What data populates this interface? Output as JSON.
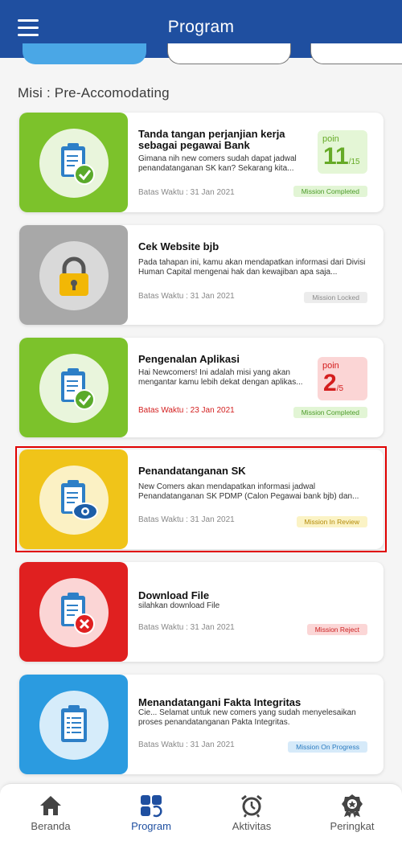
{
  "app": {
    "title": "Program"
  },
  "section": {
    "title": "Misi : Pre-Accomodating"
  },
  "missions": [
    {
      "title": "Tanda tangan perjanjian kerja sebagai pegawai Bank",
      "description": "Gimana nih new comers sudah dapat jadwal penandatanganan SK kan? Sekarang kita...",
      "deadline": "Batas Waktu : 31 Jan 2021",
      "status": "Mission Completed",
      "poin": {
        "label": "poin",
        "value": "11",
        "max": "/15"
      },
      "icon": "clipboard-check-icon",
      "tile_color": "#7cc22b"
    },
    {
      "title": "Cek Website bjb",
      "description": "Pada tahapan ini, kamu akan mendapatkan informasi dari Divisi Human Capital mengenai hak dan kewajiban apa saja...",
      "deadline": "Batas Waktu : 31 Jan 2021",
      "status": "Mission Locked",
      "icon": "padlock-icon",
      "tile_color": "#a8a8a8"
    },
    {
      "title": "Pengenalan Aplikasi",
      "description": "Hai Newcomers! Ini adalah misi yang akan mengantar kamu lebih dekat dengan aplikas...",
      "deadline": "Batas Waktu : 23 Jan 2021",
      "status": "Mission Completed",
      "poin": {
        "label": "poin",
        "value": "2",
        "max": "/5"
      },
      "icon": "clipboard-check-icon",
      "tile_color": "#7cc22b"
    },
    {
      "title": "Penandatanganan SK",
      "description": "New Comers akan mendapatkan informasi jadwal Penandatanganan SK PDMP (Calon Pegawai bank bjb) dan...",
      "deadline": "Batas Waktu : 31 Jan 2021",
      "status": "Mission In Review",
      "icon": "clipboard-eye-icon",
      "tile_color": "#f0c419"
    },
    {
      "title": "Download File",
      "description": "silahkan download File",
      "deadline": "Batas Waktu : 31 Jan 2021",
      "status": "Mission Reject",
      "icon": "clipboard-x-icon",
      "tile_color": "#e02020"
    },
    {
      "title": "Menandatangani Fakta Integritas",
      "description": "Cie... Selamat untuk new comers yang sudah menyelesaikan proses penandatanganan Pakta Integritas.",
      "deadline": "Batas Waktu : 31 Jan 2021",
      "status": "Mission On Progress",
      "icon": "clipboard-icon",
      "tile_color": "#2b9be0"
    }
  ],
  "nav": [
    {
      "label": "Beranda",
      "icon": "home-icon"
    },
    {
      "label": "Program",
      "icon": "program-icon",
      "active": true
    },
    {
      "label": "Aktivitas",
      "icon": "alarm-clock-icon"
    },
    {
      "label": "Peringkat",
      "icon": "medal-icon"
    }
  ],
  "colors": {
    "appbar": "#1f4fa0",
    "accent": "#1f4fa0"
  }
}
